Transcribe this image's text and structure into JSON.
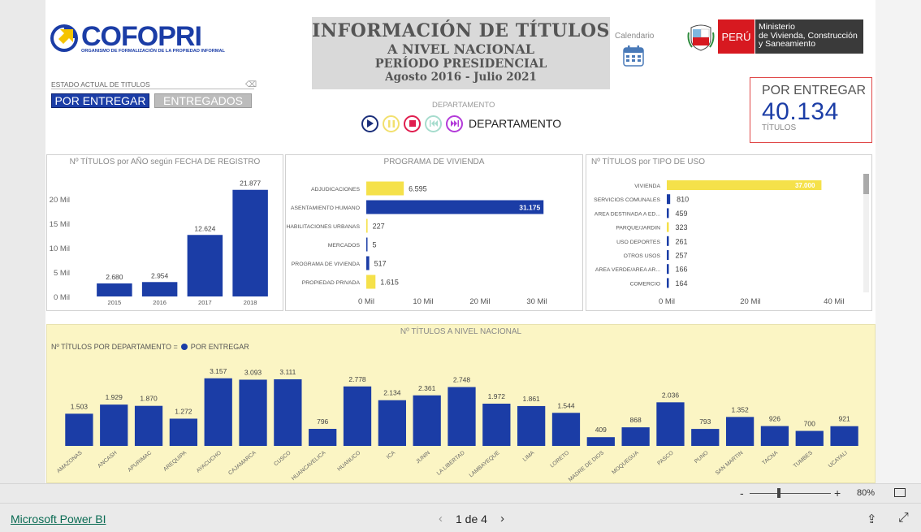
{
  "header": {
    "logo_text": "COFOPRI",
    "logo_sub": "ORGANISMO DE FORMALIZACIÓN DE LA PROPIEDAD INFORMAL",
    "title_1": "INFORMACIÓN DE TÍTULOS",
    "title_2": "A NIVEL NACIONAL",
    "title_3": "PERÍODO PRESIDENCIAL",
    "title_4": "Agosto 2016 - Julio 2021",
    "calendar_label": "Calendario",
    "peru_label": "PERÚ",
    "ministry_line1": "Ministerio",
    "ministry_line2": "de Vivienda, Construcción",
    "ministry_line3": "y Saneamiento"
  },
  "filter": {
    "label": "ESTADO ACTUAL DE TITULOS",
    "btn_active": "POR ENTREGAR",
    "btn_inactive": "ENTREGADOS"
  },
  "player": {
    "label": "DEPARTAMENTO",
    "current": "DEPARTAMENTO"
  },
  "kpi": {
    "title": "POR ENTREGAR",
    "value": "40.134",
    "unit": "TÍTULOS"
  },
  "colors": {
    "blue": "#1b3da6",
    "yellow": "#f5e14a",
    "panel_yellow": "#fbf5c4"
  },
  "chart_data": [
    {
      "type": "bar",
      "title": "Nº TÍTULOS por AÑO según FECHA DE REGISTRO",
      "categories": [
        "2015",
        "2016",
        "2017",
        "2018"
      ],
      "values": [
        2680,
        2954,
        12624,
        21877
      ],
      "value_labels": [
        "2.680",
        "2.954",
        "12.624",
        "21.877"
      ],
      "yticks": [
        "0 Mil",
        "5 Mil",
        "10 Mil",
        "15 Mil",
        "20 Mil"
      ],
      "ylim": [
        0,
        24000
      ],
      "grid": false
    },
    {
      "type": "bar",
      "orientation": "horizontal",
      "title": "PROGRAMA DE VIVIENDA",
      "categories": [
        "ADJUDICACIONES",
        "ASENTAMIENTO HUMANO",
        "HABILITACIONES URBANAS",
        "MERCADOS",
        "PROGRAMA DE VIVIENDA",
        "PROPIEDAD PRIVADA"
      ],
      "values": [
        6595,
        31175,
        227,
        5,
        517,
        1615
      ],
      "value_labels": [
        "6.595",
        "31.175",
        "227",
        "5",
        "517",
        "1.615"
      ],
      "bar_colors": [
        "#f5e14a",
        "#1b3da6",
        "#f5e14a",
        "#1b3da6",
        "#1b3da6",
        "#f5e14a"
      ],
      "xticks": [
        "0 Mil",
        "10 Mil",
        "20 Mil",
        "30 Mil"
      ],
      "xlim": [
        0,
        33000
      ]
    },
    {
      "type": "bar",
      "orientation": "horizontal",
      "title": "Nº TÍTULOS por TIPO DE USO",
      "categories": [
        "VIVIENDA",
        "SERVICIOS COMUNALES",
        "AREA DESTINADA A ED...",
        "PARQUE/JARDIN",
        "USO DEPORTES",
        "OTROS USOS",
        "AREA VERDE/AREA AR...",
        "COMERCIO"
      ],
      "values": [
        37000,
        810,
        459,
        323,
        261,
        257,
        166,
        164
      ],
      "value_labels": [
        "37.000",
        "810",
        "459",
        "323",
        "261",
        "257",
        "166",
        "164"
      ],
      "bar_colors": [
        "#f5e14a",
        "#1b3da6",
        "#1b3da6",
        "#f5e14a",
        "#1b3da6",
        "#1b3da6",
        "#1b3da6",
        "#1b3da6"
      ],
      "xticks": [
        "0 Mil",
        "20 Mil",
        "40 Mil"
      ],
      "xlim": [
        0,
        41000
      ]
    },
    {
      "type": "bar",
      "title": "Nº TÍTULOS A NIVEL NACIONAL",
      "legend_prefix": "Nº TÍTULOS POR DEPARTAMENTO =",
      "legend_series": "POR ENTREGAR",
      "categories": [
        "AMAZONAS",
        "ANCASH",
        "APURIMAC",
        "AREQUIPA",
        "AYACUCHO",
        "CAJAMARCA",
        "CUSCO",
        "HUANCAVELICA",
        "HUANUCO",
        "ICA",
        "JUNIN",
        "LA LIBERTAD",
        "LAMBAYEQUE",
        "LIMA",
        "LORETO",
        "MADRE DE DIOS",
        "MOQUEGUA",
        "PASCO",
        "PUNO",
        "SAN MARTIN",
        "TACNA",
        "TUMBES",
        "UCAYALI"
      ],
      "values": [
        1503,
        1929,
        1870,
        1272,
        3157,
        3093,
        3111,
        796,
        2778,
        2134,
        2361,
        2748,
        1972,
        1861,
        1544,
        409,
        868,
        2036,
        793,
        1352,
        926,
        700,
        921
      ],
      "value_labels": [
        "1.503",
        "1.929",
        "1.870",
        "1.272",
        "3.157",
        "3.093",
        "3.111",
        "796",
        "2.778",
        "2.134",
        "2.361",
        "2.748",
        "1.972",
        "1.861",
        "1.544",
        "409",
        "868",
        "2.036",
        "793",
        "1.352",
        "926",
        "700",
        "921"
      ]
    }
  ],
  "footer": {
    "zoom_minus": "-",
    "zoom_plus": "+",
    "zoom": "80%",
    "link": "Microsoft Power BI",
    "page": "1 de 4",
    "prev": "‹",
    "next": "›"
  }
}
